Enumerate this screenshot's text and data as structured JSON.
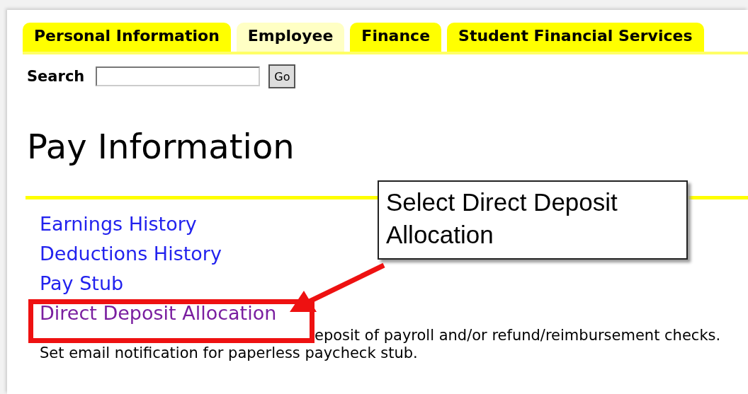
{
  "tabs": [
    {
      "label": "Personal Information",
      "selected": false
    },
    {
      "label": "Employee",
      "selected": true
    },
    {
      "label": "Finance",
      "selected": false
    },
    {
      "label": "Student Financial Services",
      "selected": false
    }
  ],
  "search": {
    "label": "Search",
    "button": "Go"
  },
  "page_title": "Pay Information",
  "links": [
    {
      "label": "Earnings History",
      "visited": false
    },
    {
      "label": "Deductions History",
      "visited": false
    },
    {
      "label": "Pay Stub",
      "visited": false
    },
    {
      "label": "Direct Deposit Allocation",
      "visited": true
    }
  ],
  "description": [
    "eposit of payroll and/or refund/reimbursement checks.",
    "Set email notification for paperless paycheck stub."
  ],
  "callout": "Select Direct Deposit Allocation"
}
